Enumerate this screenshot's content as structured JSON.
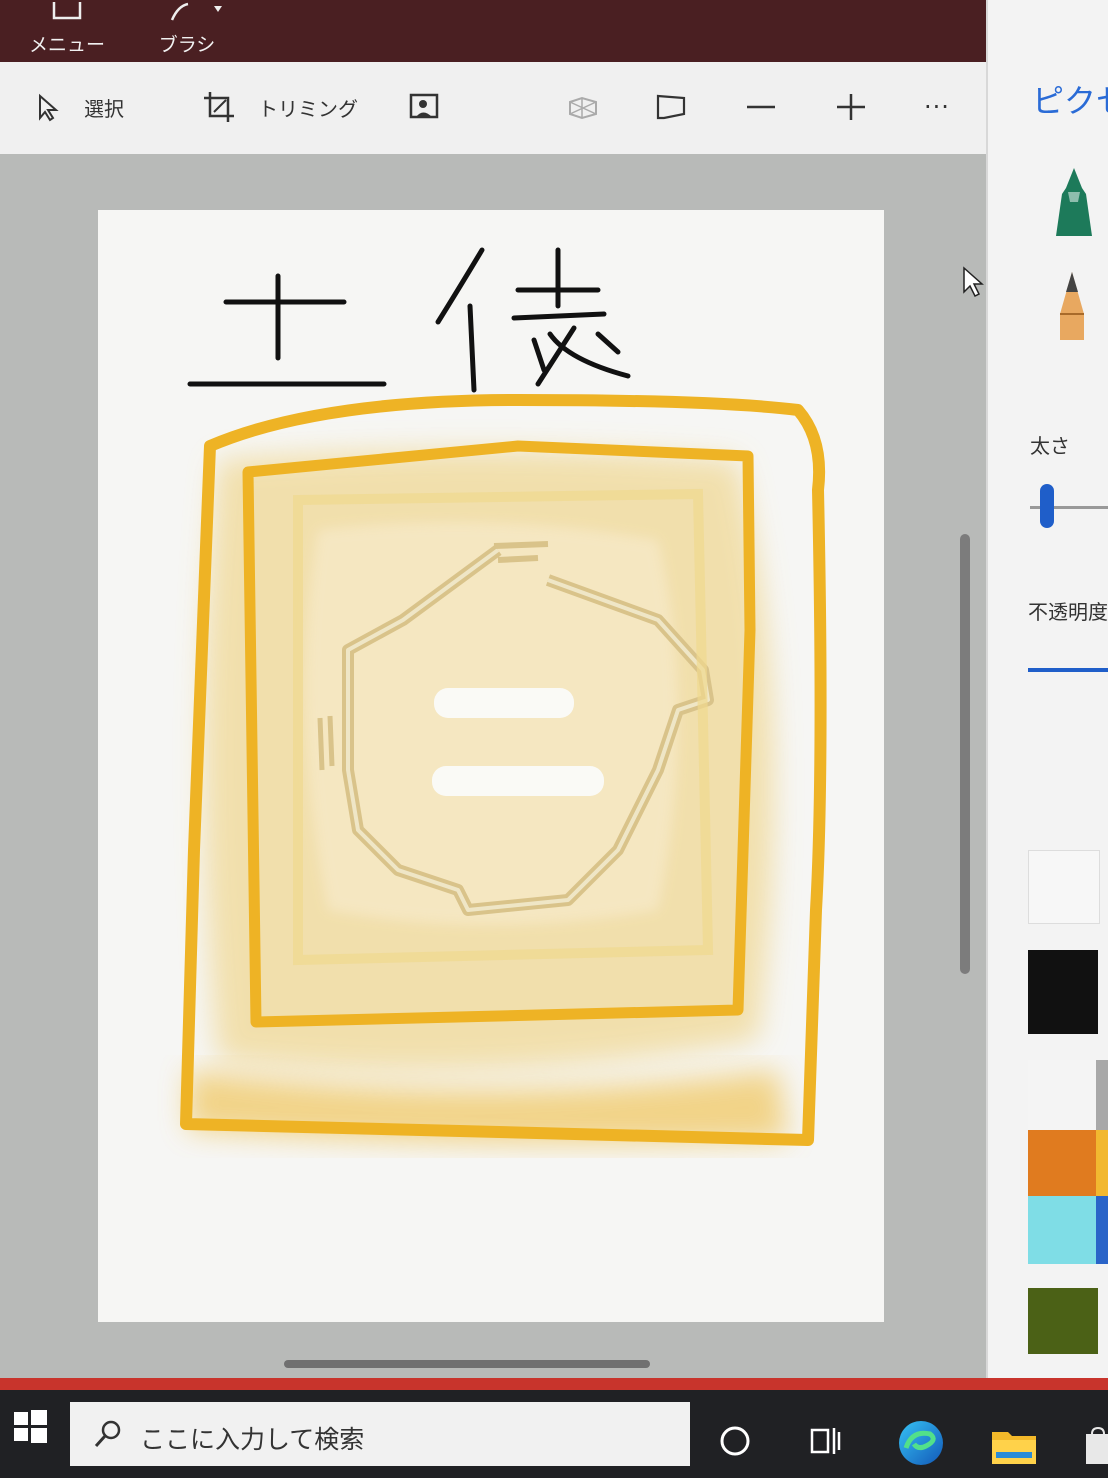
{
  "app": {
    "menu_label": "メニュー",
    "brush_label": "ブラシ"
  },
  "toolbar": {
    "select_label": "選択",
    "crop_label": "トリミング",
    "more_label": "···"
  },
  "canvas": {
    "drawing_text": "土俵"
  },
  "side_panel": {
    "title": "ピクセ",
    "thickness_label": "太さ",
    "opacity_label": "不透明度",
    "thickness_level": 0.15,
    "opacity_level": 1.0
  },
  "palette": {
    "black": "#111111",
    "white": "#f4f4f4",
    "orange": "#e07b1f",
    "cyan": "#7fdde6",
    "olive": "#4b6116",
    "yellow": "#f2b830",
    "blue": "#2a64c8"
  },
  "taskbar": {
    "search_placeholder": "ここに入力して検索"
  },
  "icons": {
    "menu": "menu-icon",
    "brush": "brush-icon",
    "select": "select-arrow-icon",
    "crop": "crop-icon",
    "magic": "magic-select-icon",
    "view3d": "3d-view-icon",
    "flag": "flag-icon",
    "zoom_out": "minus-icon",
    "zoom_in": "plus-icon",
    "more": "more-icon",
    "start": "windows-start-icon",
    "search": "search-icon",
    "cortana": "cortana-icon",
    "task_view": "task-view-icon",
    "edge": "edge-browser-icon",
    "explorer": "file-explorer-icon"
  }
}
